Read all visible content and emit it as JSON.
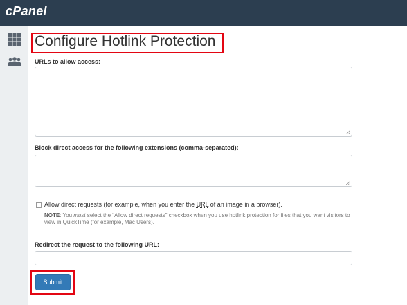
{
  "header": {
    "logo": "cPanel"
  },
  "sidebar": {
    "icons": [
      "apps-grid-icon",
      "users-icon"
    ]
  },
  "page": {
    "title": "Configure Hotlink Protection"
  },
  "form": {
    "urls_label": "URLs to allow access:",
    "urls_value": "",
    "extensions_label": "Block direct access for the following extensions (comma-separated):",
    "extensions_value": "",
    "allow_direct_label_before": "Allow direct requests (for example, when you enter the ",
    "allow_direct_label_url": "URL",
    "allow_direct_label_after": " of an image in a browser).",
    "allow_direct_checked": false,
    "note_label": "NOTE",
    "note_text_1": ": You ",
    "note_must": "must",
    "note_text_2": " select the “Allow direct requests” checkbox when you use hotlink protection for files that you want visitors to view in QuickTime (for example, Mac Users).",
    "redirect_label": "Redirect the request to the following URL:",
    "redirect_value": "",
    "submit_label": "Submit"
  },
  "colors": {
    "topbar": "#2c3e50",
    "sidebar": "#eceff1",
    "highlight": "#e30613",
    "primary_button": "#337ab7"
  }
}
